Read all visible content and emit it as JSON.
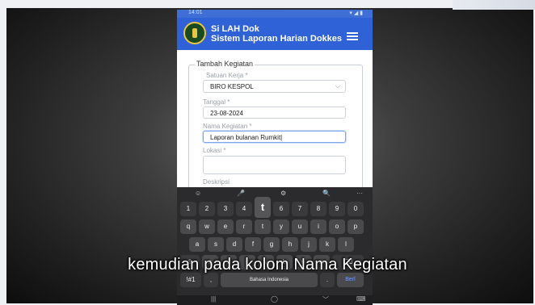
{
  "status": {
    "time": "14:01",
    "icons": "▾ ◢ ▮"
  },
  "app": {
    "title_line1": "Si LAH Dok",
    "title_line2": "Sistem Laporan Harian Dokkes"
  },
  "form": {
    "legend": "Tambah Kegiatan",
    "satuan_label": "Satuan Kerja *",
    "satuan_value": "BIRO KESPOL",
    "tanggal_label": "Tanggal *",
    "tanggal_value": "23-08-2024",
    "nama_label": "Nama Kegiatan *",
    "nama_value": "Laporan bulanan Rumkit|",
    "lokasi_label": "Lokasi *",
    "deskripsi_label": "Deskripsi"
  },
  "keyboard": {
    "tools": [
      "☺",
      "🎤",
      "⚙",
      "🔍",
      "···"
    ],
    "numbers": [
      "1",
      "2",
      "3",
      "4",
      "5",
      "6",
      "7",
      "8",
      "9",
      "0"
    ],
    "popup": "t",
    "row1": [
      "q",
      "w",
      "e",
      "r",
      "t",
      "y",
      "u",
      "i",
      "o",
      "p"
    ],
    "row2": [
      "a",
      "s",
      "d",
      "f",
      "g",
      "h",
      "j",
      "k",
      "l"
    ],
    "row3": [
      "z",
      "x",
      "c",
      "v",
      "b",
      "n",
      "m"
    ],
    "symbols": "!#1",
    "comma": ",",
    "space_label": "Bahasa Indonesia",
    "period": ".",
    "enter": "Berl"
  },
  "navbar": {
    "recent": "|||",
    "home": "◯",
    "back": "﹀",
    "kbd": "⌨"
  },
  "subtitle": "kemudian pada kolom Nama Kegiatan"
}
